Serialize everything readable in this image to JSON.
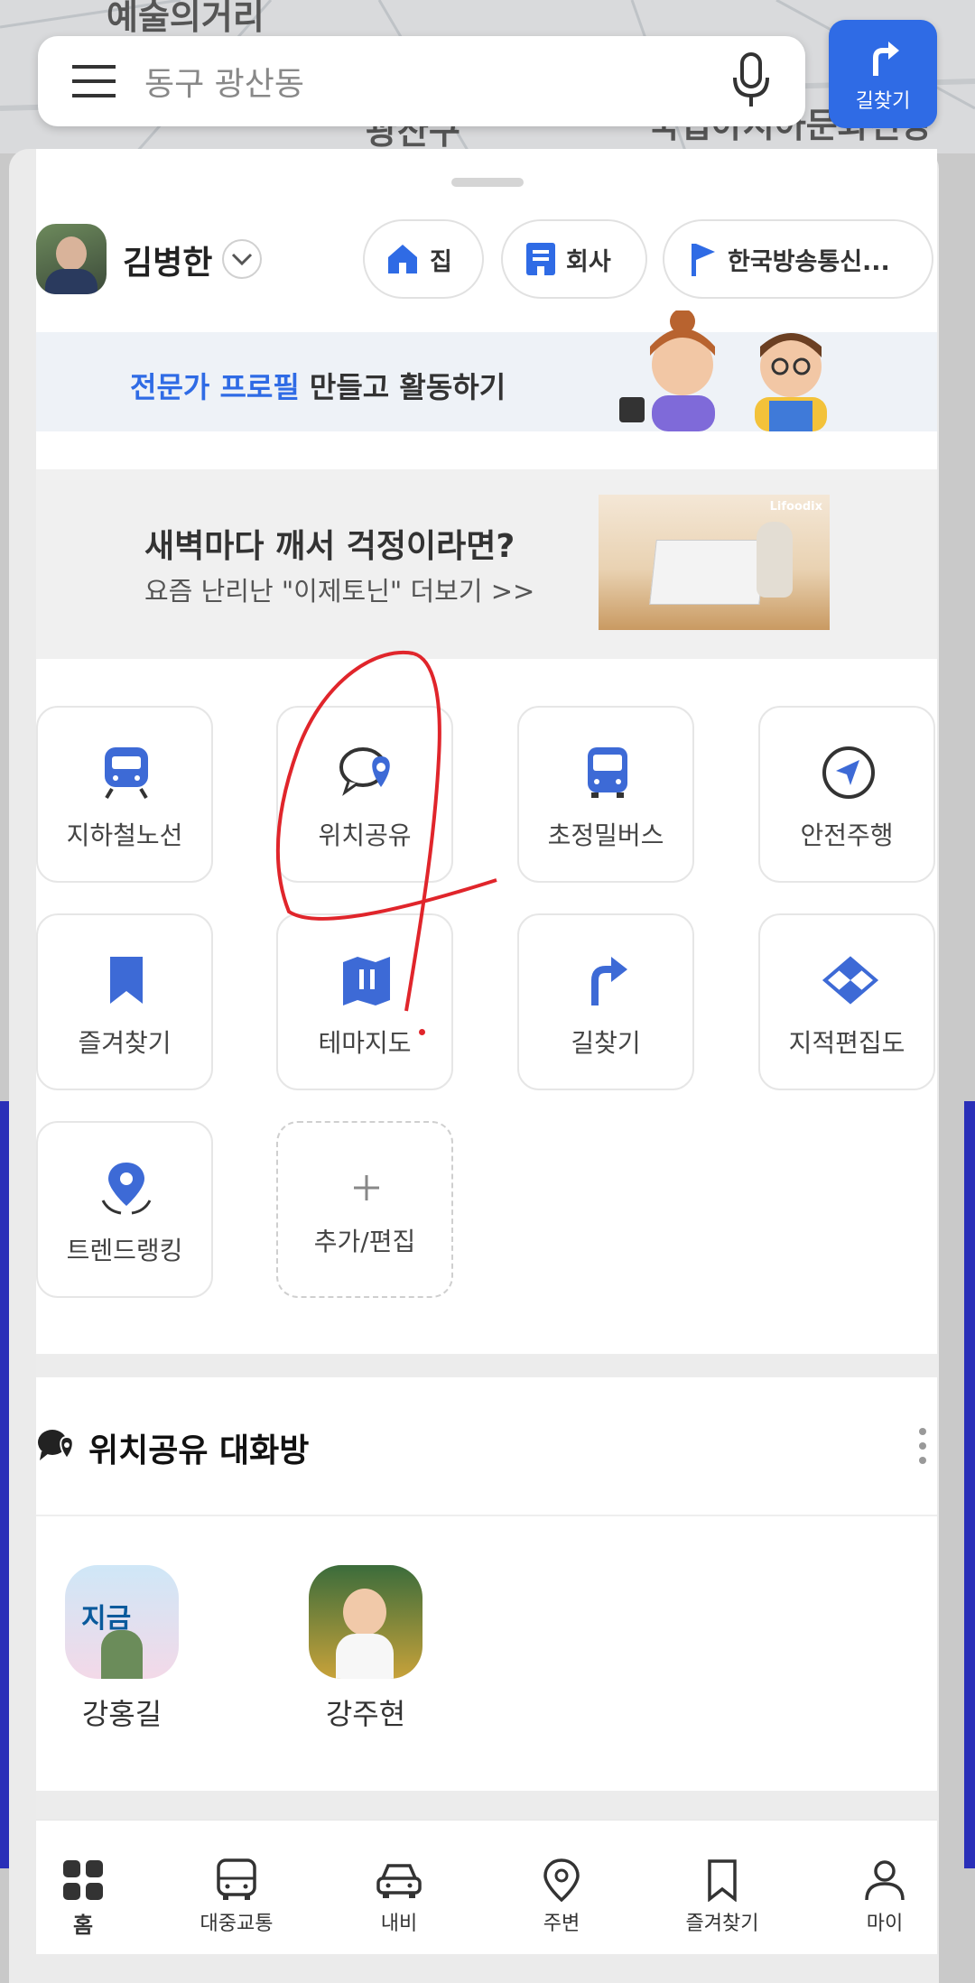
{
  "map": {
    "labels": [
      "예술의거리",
      "광산구",
      "국립아시아문화전당"
    ]
  },
  "search": {
    "placeholder": "동구 광산동"
  },
  "route_button": {
    "label": "길찾기"
  },
  "user": {
    "name": "김병한"
  },
  "chips": [
    {
      "label": "집"
    },
    {
      "label": "회사"
    },
    {
      "label": "한국방송통신..."
    }
  ],
  "expert_banner": {
    "highlight": "전문가 프로필",
    "rest": " 만들고 활동하기"
  },
  "ad_banner": {
    "title": "새벽마다 깨서 걱정이라면?",
    "subtitle": "요즘 난리난 \"이제토닌\" 더보기 >>",
    "brand": "Lifoodix"
  },
  "shortcuts": [
    {
      "label": "지하철노선",
      "icon": "subway-icon"
    },
    {
      "label": "위치공유",
      "icon": "location-share-icon"
    },
    {
      "label": "초정밀버스",
      "icon": "bus-icon"
    },
    {
      "label": "안전주행",
      "icon": "navigation-arrow-icon"
    },
    {
      "label": "즐겨찾기",
      "icon": "bookmark-icon"
    },
    {
      "label": "테마지도",
      "icon": "theme-map-icon"
    },
    {
      "label": "길찾기",
      "icon": "route-arrow-icon"
    },
    {
      "label": "지적편집도",
      "icon": "cadastral-icon"
    },
    {
      "label": "트렌드랭킹",
      "icon": "trend-ranking-icon"
    },
    {
      "label": "추가/편집",
      "icon": "plus-icon"
    }
  ],
  "chat_section": {
    "title": "위치공유 대화방",
    "members": [
      {
        "name": "강홍길",
        "avatar_text": "지금"
      },
      {
        "name": "강주현"
      }
    ]
  },
  "bottom_nav": [
    {
      "label": "홈",
      "icon": "home-grid-icon"
    },
    {
      "label": "대중교통",
      "icon": "bus-outline-icon"
    },
    {
      "label": "내비",
      "icon": "car-icon"
    },
    {
      "label": "주변",
      "icon": "pin-icon"
    },
    {
      "label": "즐겨찾기",
      "icon": "bookmark-outline-icon"
    },
    {
      "label": "마이",
      "icon": "person-icon"
    }
  ],
  "colors": {
    "accent": "#2f6be5",
    "annotation": "#e0252b"
  }
}
